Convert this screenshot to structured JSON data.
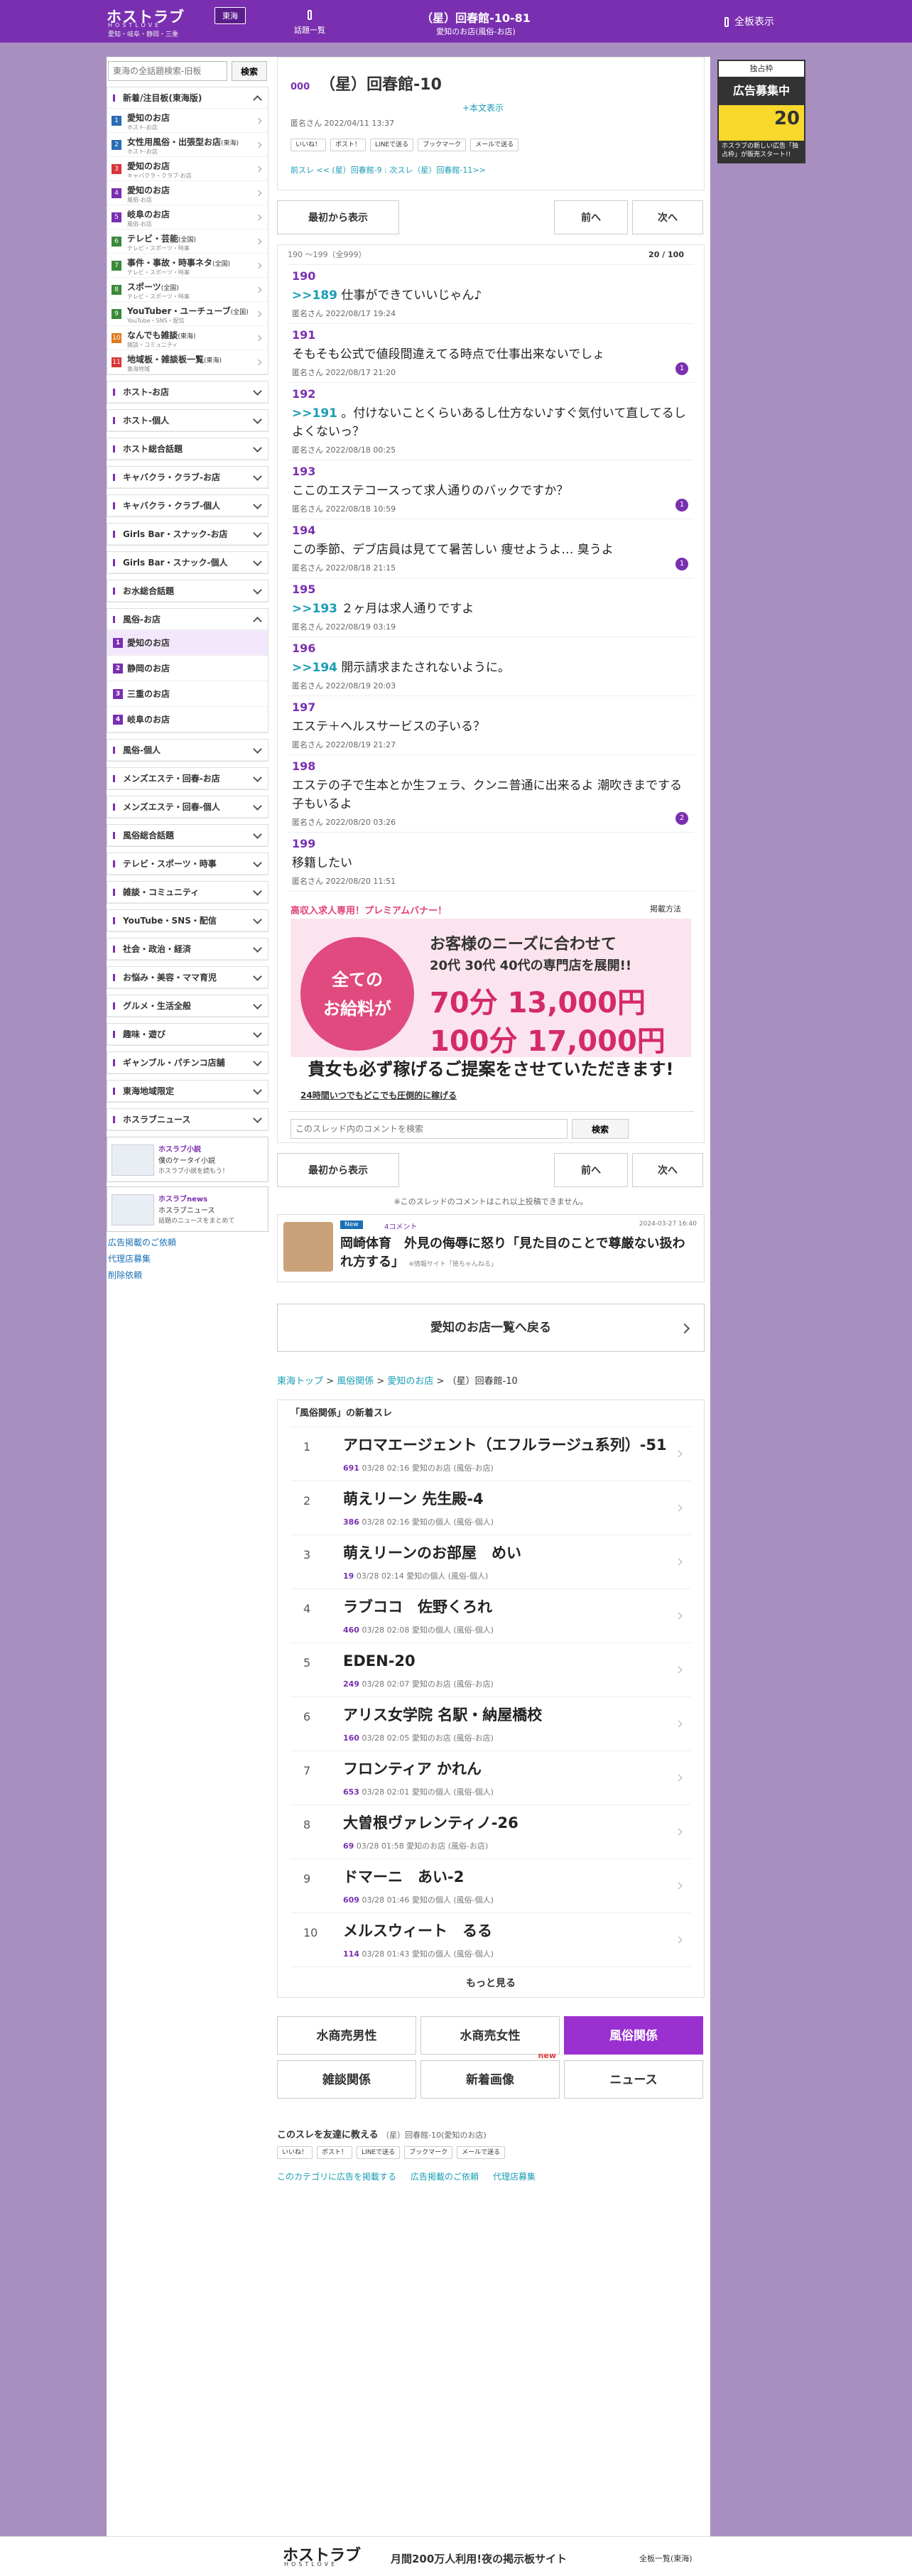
{
  "header": {
    "logo": "ホストラブ",
    "logo_sub": "HOSTLOVE",
    "logo_area": "愛知・岐阜・静岡・三重",
    "region": "東海",
    "list_label": "話題一覧",
    "title": "（星）回春館-10-81",
    "subtitle": "愛知のお店(風俗-お店)",
    "all_board": "全板表示"
  },
  "sidebar": {
    "search_placeholder": "東海の全話題検索-旧板",
    "search_button": "検索",
    "section1_title": "新着/注目板(東海版)",
    "items": [
      {
        "n": "1",
        "t": "愛知のお店",
        "s": "ホスト-お店",
        "c": "#2a6db5"
      },
      {
        "n": "2",
        "t": "女性用風俗・出張型お店",
        "s": "ホスト-お店",
        "c": "#2a6db5",
        "tag": "(東海)"
      },
      {
        "n": "3",
        "t": "愛知のお店",
        "s": "キャバクラ・クラブ-お店",
        "c": "#d8353a"
      },
      {
        "n": "4",
        "t": "愛知のお店",
        "s": "風俗-お店",
        "c": "#7a2fb0"
      },
      {
        "n": "5",
        "t": "岐阜のお店",
        "s": "風俗-お店",
        "c": "#7a2fb0"
      },
      {
        "n": "6",
        "t": "テレビ・芸能",
        "s": "テレビ・スポーツ・時事",
        "c": "#3a8a3a",
        "tag": "(全国)"
      },
      {
        "n": "7",
        "t": "事件・事故・時事ネタ",
        "s": "テレビ・スポーツ・時事",
        "c": "#3a8a3a",
        "tag": "(全国)"
      },
      {
        "n": "8",
        "t": "スポーツ",
        "s": "テレビ・スポーツ・時事",
        "c": "#3a8a3a",
        "tag": "(全国)"
      },
      {
        "n": "9",
        "t": "YouTuber・ユーチューブ",
        "s": "YouTube・SNS・配信",
        "c": "#3a8a3a",
        "tag": "(全国)"
      },
      {
        "n": "10",
        "t": "なんでも雑談",
        "s": "雑談・コミュニティ",
        "c": "#e07a1a",
        "tag": "(東海)"
      },
      {
        "n": "11",
        "t": "地域板・雑談板一覧",
        "s": "東海地域",
        "c": "#d8353a",
        "tag": "(東海)"
      }
    ],
    "cats": [
      "ホスト-お店",
      "ホスト-個人",
      "ホスト総合話題",
      "キャバクラ・クラブ-お店",
      "キャバクラ・クラブ-個人",
      "Girls Bar・スナック-お店",
      "Girls Bar・スナック-個人",
      "お水総合話題"
    ],
    "fuzoku_title": "風俗-お店",
    "fuzoku_items": [
      {
        "n": "1",
        "t": "愛知のお店"
      },
      {
        "n": "2",
        "t": "静岡のお店"
      },
      {
        "n": "3",
        "t": "三重のお店"
      },
      {
        "n": "4",
        "t": "岐阜のお店"
      }
    ],
    "cats2": [
      "風俗-個人",
      "メンズエステ・回春-お店",
      "メンズエステ・回春-個人",
      "風俗総合話題",
      "テレビ・スポーツ・時事",
      "雑談・コミュニティ",
      "YouTube・SNS・配信",
      "社会・政治・経済",
      "お悩み・美容・ママ育児",
      "グルメ・生活全般",
      "趣味・遊び",
      "ギャンブル・パチンコ店舗",
      "東海地域限定",
      "ホスラブニュース"
    ],
    "banner1": {
      "l1": "ホスラブ小説",
      "l2": "僕のケータイ小説",
      "l3": "ホスラブ小説を読もう！"
    },
    "banner2": {
      "l1": "ホスラブnews",
      "l2": "ホスラブニュース",
      "l3": "話題のニュースをまとめて"
    },
    "links": [
      "広告掲載のご依頼",
      "代理店募集",
      "削除依頼"
    ]
  },
  "thread": {
    "num": "000",
    "title": "（星）回春館-10",
    "honbun": "+本文表示",
    "meta": "匿名さん 2022/04/11 13:37",
    "shares": [
      "いいね！",
      "ポスト！",
      "LINEで送る",
      "ブックマーク",
      "メールで送る"
    ],
    "nav": "前スレ << (星）回春館-9 : 次スレ（星）回春館-11>>"
  },
  "pager": {
    "first": "最初から表示",
    "prev": "前へ",
    "next": "次へ"
  },
  "res_range": "190 〜199（全999）",
  "res_page": "20 / 100",
  "responses": [
    {
      "no": "190",
      "anc": ">>189",
      "text": "仕事ができていいじゃん♪",
      "meta": "匿名さん 2022/08/17 19:24",
      "cnt": ""
    },
    {
      "no": "191",
      "anc": "",
      "text": "そもそも公式で値段間違えてる時点で仕事出来ないでしょ",
      "meta": "匿名さん 2022/08/17 21:20",
      "cnt": "1"
    },
    {
      "no": "192",
      "anc": ">>191",
      "text": "。付けないことくらいあるし仕方ない♪すぐ気付いて直してるしよくないっ？",
      "meta": "匿名さん 2022/08/18 00:25",
      "cnt": ""
    },
    {
      "no": "193",
      "anc": "",
      "text": "ここのエステコースって求人通りのバックですか？",
      "meta": "匿名さん 2022/08/18 10:59",
      "cnt": "1"
    },
    {
      "no": "194",
      "anc": "",
      "text": "この季節、デブ店員は見てて暑苦しい 痩せようよ… 臭うよ",
      "meta": "匿名さん 2022/08/18 21:15",
      "cnt": "1"
    },
    {
      "no": "195",
      "anc": ">>193",
      "text": "２ヶ月は求人通りですよ",
      "meta": "匿名さん 2022/08/19 03:19",
      "cnt": ""
    },
    {
      "no": "196",
      "anc": ">>194",
      "text": "開示請求またされないように。",
      "meta": "匿名さん 2022/08/19 20:03",
      "cnt": ""
    },
    {
      "no": "197",
      "anc": "",
      "text": "エステ＋ヘルスサービスの子いる？",
      "meta": "匿名さん 2022/08/19 21:27",
      "cnt": ""
    },
    {
      "no": "198",
      "anc": "",
      "text": "エステの子で生本とか生フェラ、クンニ普通に出来るよ 潮吹きまでする子もいるよ",
      "meta": "匿名さん 2022/08/20 03:26",
      "cnt": "2"
    },
    {
      "no": "199",
      "anc": "",
      "text": "移籍したい",
      "meta": "匿名さん 2022/08/20 11:51",
      "cnt": ""
    }
  ],
  "premium": {
    "title": "高収入求人専用！プレミアムバナー！",
    "right": "掲載方法",
    "c1": "全ての",
    "c2": "お給料が",
    "h1": "お客様のニーズに合わせて",
    "h2": "20代 30代 40代の専門店を展開!!",
    "h3": "70分 13,000円",
    "h4": "100分 17,000円",
    "foot": "貴女も必ず稼げるご提案をさせていただきます!",
    "link": "24時間いつでもどこでも圧倒的に稼げる"
  },
  "comment_search": {
    "placeholder": "このスレッド内のコメントを検索",
    "button": "検索"
  },
  "note": "※このスレッドのコメントはこれ以上投稿できません。",
  "news": {
    "badge": "New",
    "comments": "4コメント",
    "date": "2024-03-27 16:40",
    "title": "岡崎体育　外見の侮辱に怒り「見た目のことで尊厳ない扱われ方する」",
    "src": "※情報サイト「徳ちゃんねる」"
  },
  "back": "愛知のお店一覧へ戻る",
  "breadcrumb": {
    "a": "東海トップ",
    "b": "風俗関係",
    "c": "愛知のお店",
    "d": "（星）回春館-10"
  },
  "newlist": {
    "title": "「風俗関係」の新着スレ",
    "items": [
      {
        "rk": "1",
        "tt": "アロマエージェント（エフルラージュ系列）-51",
        "cnt": "691",
        "mt": "03/28 02:16  愛知のお店 (風俗-お店)"
      },
      {
        "rk": "2",
        "tt": "萌えリーン 先生殿-4",
        "cnt": "386",
        "mt": "03/28 02:16  愛知の個人 (風俗-個人)"
      },
      {
        "rk": "3",
        "tt": "萌えリーンのお部屋　めい",
        "cnt": "19",
        "mt": "03/28 02:14  愛知の個人 (風俗-個人)"
      },
      {
        "rk": "4",
        "tt": "ラブココ　佐野くろれ",
        "cnt": "460",
        "mt": "03/28 02:08  愛知の個人 (風俗-個人)"
      },
      {
        "rk": "5",
        "tt": "EDEN-20",
        "cnt": "249",
        "mt": "03/28 02:07  愛知のお店 (風俗-お店)"
      },
      {
        "rk": "6",
        "tt": "アリス女学院 名駅・納屋橋校",
        "cnt": "160",
        "mt": "03/28 02:05  愛知のお店 (風俗-お店)"
      },
      {
        "rk": "7",
        "tt": "フロンティア かれん",
        "cnt": "653",
        "mt": "03/28 02:01  愛知の個人 (風俗-個人)"
      },
      {
        "rk": "8",
        "tt": "大曽根ヴァレンティノ-26",
        "cnt": "69",
        "mt": "03/28 01:58  愛知のお店 (風俗-お店)"
      },
      {
        "rk": "9",
        "tt": "ドマーニ　あい-2",
        "cnt": "609",
        "mt": "03/28 01:46  愛知の個人 (風俗-個人)"
      },
      {
        "rk": "10",
        "tt": "メルスウィート　るる",
        "cnt": "114",
        "mt": "03/28 01:43  愛知の個人 (風俗-個人)"
      }
    ],
    "more": "もっと見る"
  },
  "cats": [
    "水商売男性",
    "水商売女性",
    "風俗関係",
    "雑談関係",
    "新着画像",
    "ニュース"
  ],
  "cat_new": "new",
  "share2": {
    "title": "このスレを友達に教える",
    "sub": "（星）回春館-10(愛知のお店)"
  },
  "flinks": [
    "このカテゴリに広告を掲載する",
    "広告掲載のご依頼",
    "代理店募集"
  ],
  "rightad": {
    "top": "独占枠",
    "mid": "広告募集中",
    "k": "20"
  },
  "rightad_btm": "ホスラブの新しい広告「独占枠」が販売スタート!!",
  "footer": {
    "logo": "ホストラブ",
    "logo_sub": "HOSTLOVE",
    "copy": "月間200万人利用!夜の掲示板サイト",
    "right": "全板一覧(東海)"
  }
}
